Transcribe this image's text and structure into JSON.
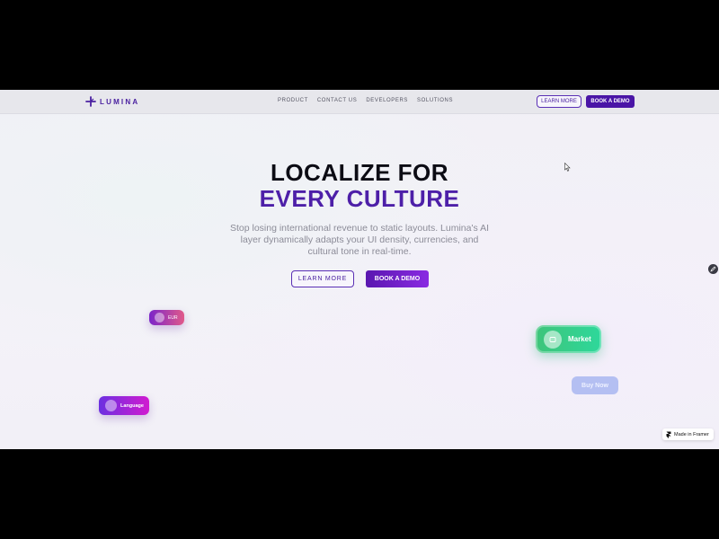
{
  "brand": {
    "name": "LUMINA",
    "color": "#4a21a0"
  },
  "nav": {
    "links": [
      "PRODUCT",
      "CONTACT US",
      "DEVELOPERS",
      "SOLUTIONS"
    ],
    "learn_more": "LEARN MORE",
    "book_demo": "BOOK A DEMO"
  },
  "hero": {
    "title_line1": "LOCALIZE FOR",
    "title_line2": "EVERY CULTURE",
    "subtitle": "Stop losing international revenue to static layouts. Lumina's AI layer dynamically adapts your UI density, currencies, and cultural tone in real-time.",
    "learn_more": "LEARN MORE",
    "book_demo": "BOOK A DEMO"
  },
  "chips": {
    "currency": "EUR",
    "language": "Language",
    "market": "Market",
    "buy": "Buy Now"
  },
  "badge": {
    "label": "Made in Framer",
    "icon": "framer-icon"
  },
  "colors": {
    "accent": "#4d1fa8",
    "market_green": "#3ec47a",
    "buy_button": "#b4bff2"
  }
}
